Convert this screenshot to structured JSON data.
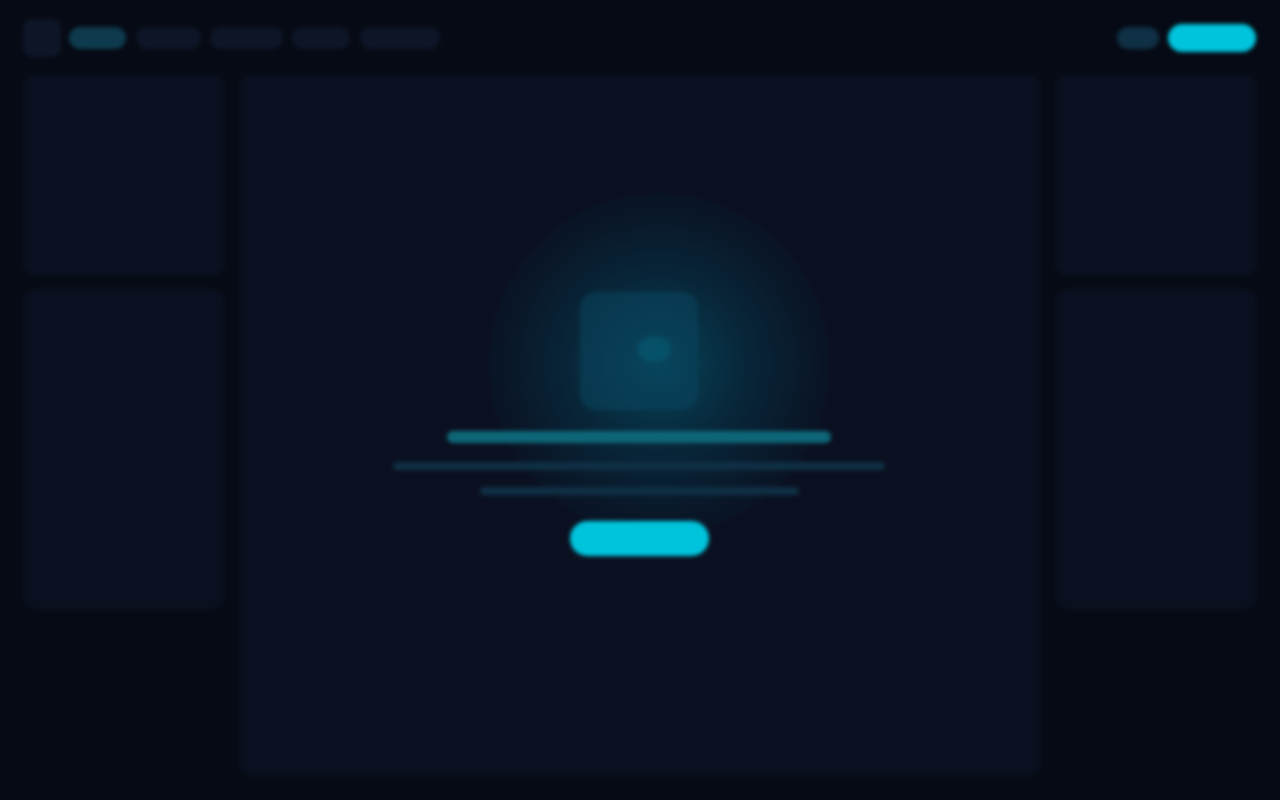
{
  "colors": {
    "background": "#060a14",
    "panel": "#0a1020",
    "accent": "#00c4dc",
    "muted_pill": "#0d1627",
    "active_pill": "#0d3a4d"
  },
  "topbar": {
    "nav_items": 5,
    "active_index": 0
  },
  "main": {
    "state": "empty-loading-skeleton",
    "icon": "placeholder-icon"
  }
}
